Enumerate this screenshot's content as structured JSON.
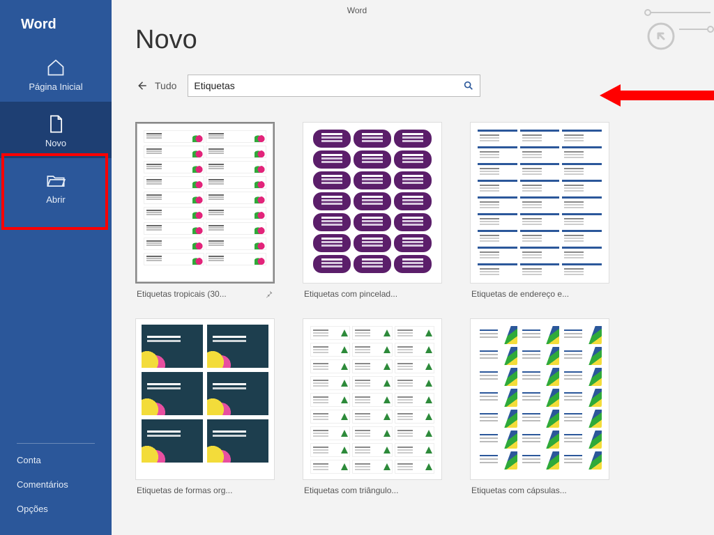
{
  "app": {
    "title": "Word",
    "brand": "Word"
  },
  "sidebar": {
    "items": [
      {
        "label": "Página Inicial"
      },
      {
        "label": "Novo"
      },
      {
        "label": "Abrir"
      }
    ],
    "footer": [
      {
        "label": "Conta"
      },
      {
        "label": "Comentários"
      },
      {
        "label": "Opções"
      }
    ]
  },
  "main": {
    "title": "Novo",
    "breadcrumb": "Tudo",
    "search": {
      "value": "Etiquetas"
    }
  },
  "templates": [
    {
      "label": "Etiquetas tropicais (30...",
      "style": "tropical",
      "selected": true,
      "pinned": true
    },
    {
      "label": "Etiquetas com pincelad...",
      "style": "brush"
    },
    {
      "label": "Etiquetas de endereço e...",
      "style": "address"
    },
    {
      "label": "Etiquetas de formas org...",
      "style": "organic"
    },
    {
      "label": "Etiquetas com triângulo...",
      "style": "triangle"
    },
    {
      "label": "Etiquetas com cápsulas...",
      "style": "capsule"
    }
  ]
}
